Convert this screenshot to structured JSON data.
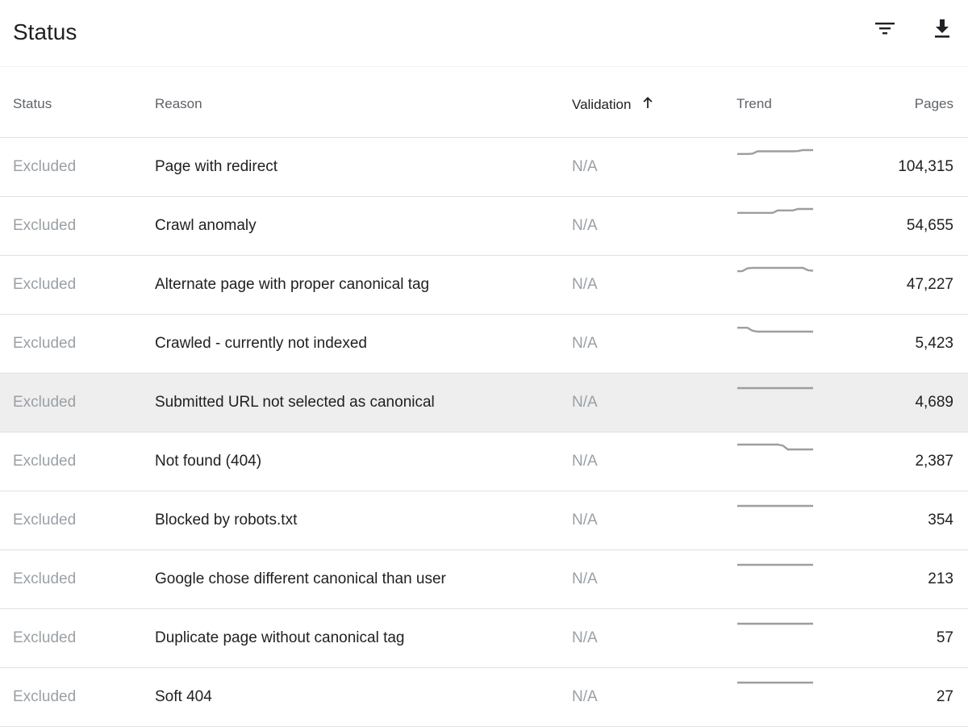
{
  "header": {
    "title": "Status",
    "filter_icon": "filter-icon",
    "download_icon": "download-icon"
  },
  "columns": {
    "status": "Status",
    "reason": "Reason",
    "validation": "Validation",
    "validation_sort_icon": "arrow-up-icon",
    "trend": "Trend",
    "pages": "Pages"
  },
  "rows": [
    {
      "status": "Excluded",
      "reason": "Page with redirect",
      "validation": "N/A",
      "pages": "104,315",
      "trend": [
        0.2,
        0.2,
        0.2,
        0.25,
        0.75,
        0.75,
        0.75,
        0.75,
        0.75,
        0.75,
        0.75,
        0.75,
        0.8,
        1.0,
        1.0,
        1.0
      ]
    },
    {
      "status": "Excluded",
      "reason": "Crawl anomaly",
      "validation": "N/A",
      "pages": "54,655",
      "trend": [
        0.2,
        0.2,
        0.2,
        0.2,
        0.2,
        0.2,
        0.2,
        0.2,
        0.7,
        0.7,
        0.7,
        0.7,
        1.0,
        1.0,
        1.0,
        1.0
      ]
    },
    {
      "status": "Excluded",
      "reason": "Alternate page with proper canonical tag",
      "validation": "N/A",
      "pages": "47,227",
      "trend": [
        0.3,
        0.35,
        0.9,
        1.0,
        1.0,
        1.0,
        1.0,
        1.0,
        1.0,
        1.0,
        1.0,
        1.0,
        1.0,
        1.0,
        0.5,
        0.4
      ]
    },
    {
      "status": "Excluded",
      "reason": "Crawled - currently not indexed",
      "validation": "N/A",
      "pages": "5,423",
      "trend": [
        0.8,
        0.8,
        0.8,
        0.2,
        0.0,
        0.0,
        0.0,
        0.0,
        0.0,
        0.0,
        0.0,
        0.0,
        0.0,
        0.0,
        0.0,
        0.0
      ]
    },
    {
      "status": "Excluded",
      "reason": "Submitted URL not selected as canonical",
      "validation": "N/A",
      "pages": "4,689",
      "trend": [
        0.5,
        0.5,
        0.5,
        0.5,
        0.5,
        0.5,
        0.5,
        0.5,
        0.5,
        0.5,
        0.5,
        0.5,
        0.5,
        0.5,
        0.5,
        0.5
      ]
    },
    {
      "status": "Excluded",
      "reason": "Not found (404)",
      "validation": "N/A",
      "pages": "2,387",
      "trend": [
        1.0,
        1.0,
        1.0,
        1.0,
        1.0,
        1.0,
        1.0,
        1.0,
        1.0,
        0.8,
        0.0,
        0.0,
        0.0,
        0.0,
        0.0,
        0.0
      ]
    },
    {
      "status": "Excluded",
      "reason": "Blocked by robots.txt",
      "validation": "N/A",
      "pages": "354",
      "trend": [
        0.5,
        0.5,
        0.5,
        0.5,
        0.5,
        0.5,
        0.5,
        0.5,
        0.5,
        0.5,
        0.5,
        0.5,
        0.5,
        0.5,
        0.5,
        0.5
      ]
    },
    {
      "status": "Excluded",
      "reason": "Google chose different canonical than user",
      "validation": "N/A",
      "pages": "213",
      "trend": [
        0.5,
        0.5,
        0.5,
        0.5,
        0.5,
        0.5,
        0.5,
        0.5,
        0.5,
        0.5,
        0.5,
        0.5,
        0.5,
        0.5,
        0.5,
        0.5
      ]
    },
    {
      "status": "Excluded",
      "reason": "Duplicate page without canonical tag",
      "validation": "N/A",
      "pages": "57",
      "trend": [
        0.5,
        0.5,
        0.5,
        0.5,
        0.5,
        0.5,
        0.5,
        0.5,
        0.5,
        0.5,
        0.5,
        0.5,
        0.5,
        0.5,
        0.5,
        0.5
      ]
    },
    {
      "status": "Excluded",
      "reason": "Soft 404",
      "validation": "N/A",
      "pages": "27",
      "trend": [
        0.5,
        0.5,
        0.5,
        0.5,
        0.5,
        0.5,
        0.5,
        0.5,
        0.5,
        0.5,
        0.5,
        0.5,
        0.5,
        0.5,
        0.5,
        0.5
      ]
    }
  ],
  "highlighted_row": 4,
  "colors": {
    "trend_line": "#9e9e9e",
    "muted_text": "#9aa0a6",
    "row_highlight": "#eeeeee"
  }
}
